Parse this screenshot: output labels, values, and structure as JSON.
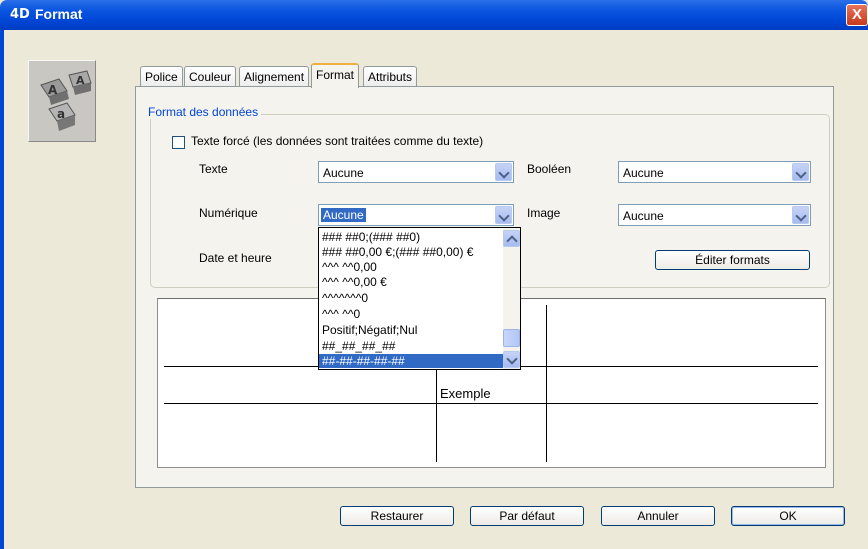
{
  "window": {
    "logo": "4D",
    "title": "Format",
    "close": "X"
  },
  "tabs": [
    {
      "label": "Police"
    },
    {
      "label": "Couleur"
    },
    {
      "label": "Alignement"
    },
    {
      "label": "Format",
      "active": true
    },
    {
      "label": "Attributs"
    }
  ],
  "group": {
    "legend": "Format des données",
    "forced_text_checkbox": {
      "label": "Texte forcé (les données sont traitées comme du texte)",
      "checked": false
    },
    "fields": {
      "texte": {
        "label": "Texte",
        "value": "Aucune"
      },
      "booleen": {
        "label": "Booléen",
        "value": "Aucune"
      },
      "numerique": {
        "label": "Numérique",
        "value": "Aucune"
      },
      "image": {
        "label": "Image",
        "value": "Aucune"
      },
      "date": {
        "label": "Date et heure"
      }
    },
    "edit_formats_button": "Éditer formats"
  },
  "numeric_dropdown": {
    "options": [
      "### ##0;(### ##0)",
      "### ##0,00 €;(### ##0,00) €",
      "^^^ ^^0,00",
      "^^^ ^^0,00 €",
      "^^^^^^^0",
      "^^^ ^^0",
      "Positif;Négatif;Nul",
      "##_##_##_##",
      "##-##-##-##-##"
    ],
    "highlighted": "##-##-##-##-##"
  },
  "preview": {
    "sample_text": "Exemple"
  },
  "footer": {
    "restore": "Restaurer",
    "default": "Par défaut",
    "cancel": "Annuler",
    "ok": "OK"
  },
  "colors": {
    "titlebar": "#0046d5",
    "selection": "#316ac5",
    "group_legend": "#0046d5",
    "active_tab_accent": "#f0b040"
  }
}
